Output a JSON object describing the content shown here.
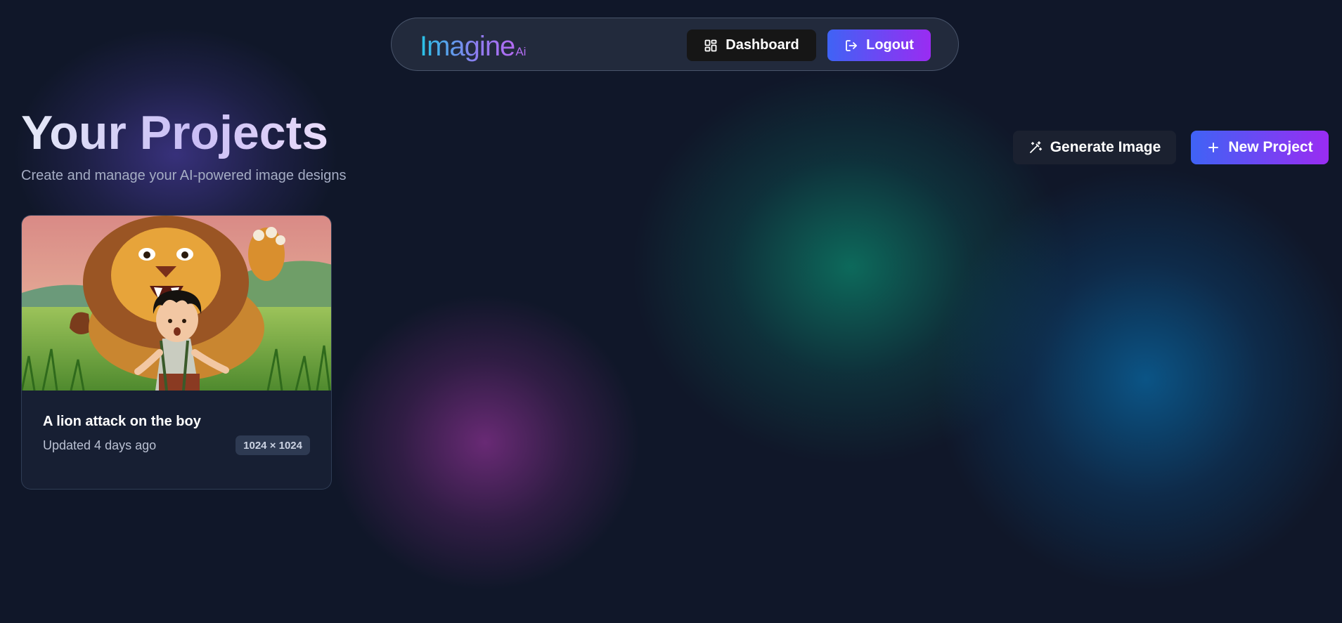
{
  "navbar": {
    "logo_main": "Imagine",
    "logo_sub": "Ai",
    "dashboard_label": "Dashboard",
    "logout_label": "Logout",
    "dashboard_icon": "layout-grid-icon",
    "logout_icon": "logout-icon"
  },
  "header": {
    "title": "Your Projects",
    "subtitle": "Create and manage your AI-powered image designs"
  },
  "actions": {
    "generate_label": "Generate Image",
    "generate_icon": "magic-wand-icon",
    "new_project_label": "New Project",
    "new_project_icon": "plus-icon"
  },
  "projects": [
    {
      "title": "A lion attack on the boy",
      "updated": "Updated 4 days ago",
      "dimensions": "1024 × 1024"
    }
  ],
  "colors": {
    "background": "#101729",
    "accent_gradient_start": "#3f63f5",
    "accent_gradient_end": "#9a2cf2",
    "navbar_bg": "#242c3e"
  }
}
